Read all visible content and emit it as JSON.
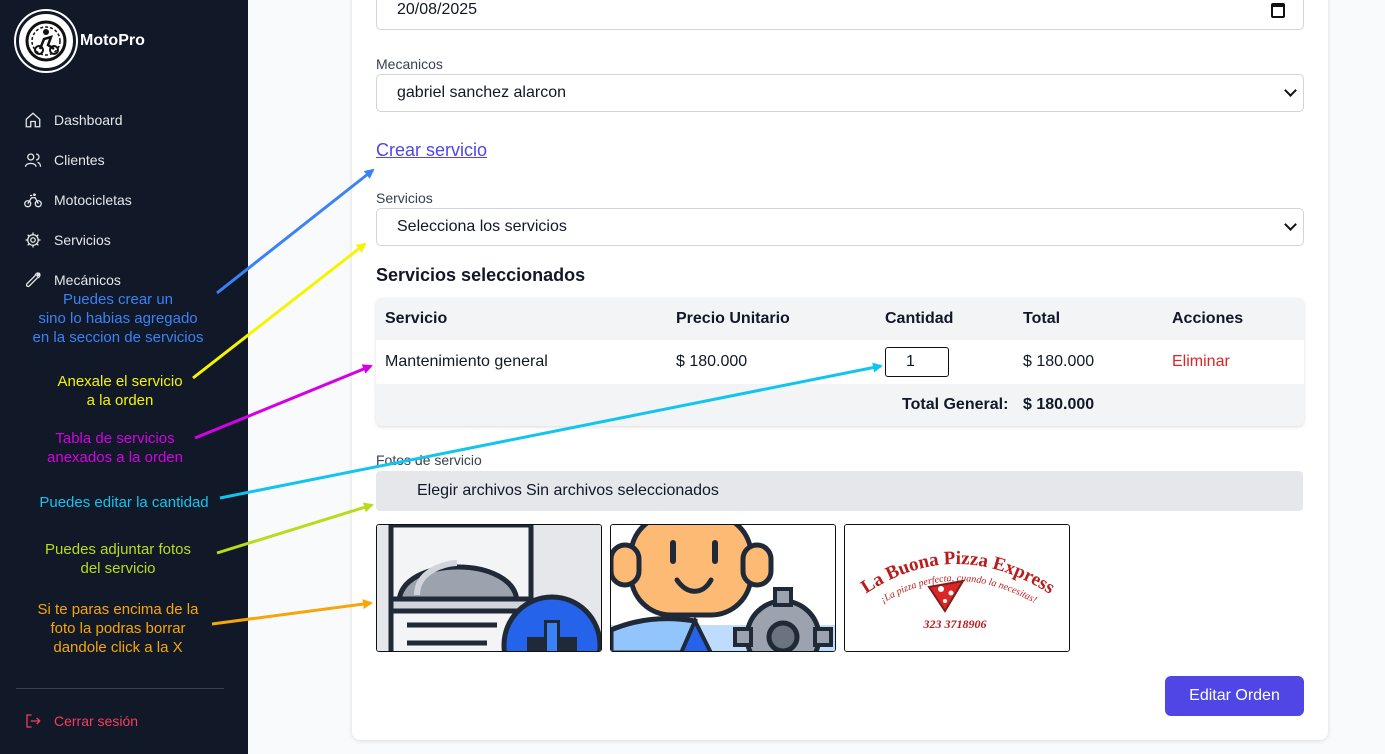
{
  "sidebar": {
    "brand": "MotoPro",
    "items": [
      {
        "label": "Dashboard",
        "icon": "home-icon"
      },
      {
        "label": "Clientes",
        "icon": "users-icon"
      },
      {
        "label": "Motocicletas",
        "icon": "bike-icon"
      },
      {
        "label": "Servicios",
        "icon": "gear-icon"
      },
      {
        "label": "Mecánicos",
        "icon": "wrench-icon"
      }
    ],
    "logout": "Cerrar sesión"
  },
  "notes": {
    "crear": [
      "Puedes crear un",
      "sino lo habias agregado",
      "en la seccion de servicios"
    ],
    "anexale": [
      "Anexale el servicio",
      "a la orden"
    ],
    "tabla": [
      "Tabla de servicios",
      "anexados a la orden"
    ],
    "cantidad": [
      "Puedes editar la cantidad"
    ],
    "fotos": [
      "Puedes adjuntar fotos",
      "del servicio"
    ],
    "borrar": [
      "Si te paras encima de la",
      "foto la podras borrar",
      "dandole click a la X"
    ]
  },
  "colors": {
    "blue": "#3b82f6",
    "yellow": "#f5f500",
    "magenta": "#d400e6",
    "cyan": "#12c4ee",
    "lime": "#b8dc1a",
    "orange": "#f5a60a",
    "accent": "#4f46e5"
  },
  "form": {
    "date_value": "20/08/2025",
    "mecanicos_label": "Mecanicos",
    "mecanico_value": "gabriel sanchez alarcon",
    "crear_servicio": "Crear servicio",
    "servicios_label": "Servicios",
    "servicios_placeholder": "Selecciona los servicios",
    "selected_title": "Servicios seleccionados",
    "table": {
      "headers": [
        "Servicio",
        "Precio Unitario",
        "Cantidad",
        "Total",
        "Acciones"
      ],
      "rows": [
        {
          "servicio": "Mantenimiento general",
          "precio": "$ 180.000",
          "cantidad": "1",
          "total": "$ 180.000",
          "accion": "Eliminar"
        }
      ],
      "total_label": "Total General:",
      "total_value": "$ 180.000"
    },
    "fotos_label": "Fotos de servicio",
    "file_button": "Elegir archivos",
    "file_status": "Sin archivos seleccionados",
    "photo3": {
      "title": "La Buona Pizza Express",
      "tagline": "¡La pizza perfecta, cuando la necesitas!",
      "phone": "323 3718906"
    },
    "submit": "Editar Orden"
  }
}
